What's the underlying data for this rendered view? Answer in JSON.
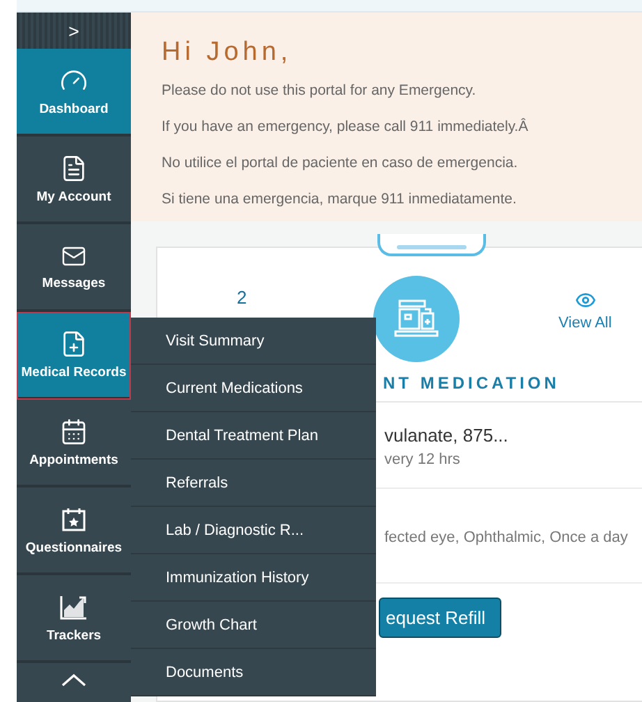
{
  "sidebar": {
    "toggle": ">",
    "items": [
      {
        "label": "Dashboard",
        "selected": true,
        "highlighted": false
      },
      {
        "label": "My Account",
        "selected": false,
        "highlighted": false
      },
      {
        "label": "Messages",
        "selected": false,
        "highlighted": false
      },
      {
        "label": "Medical Records",
        "selected": true,
        "highlighted": true
      },
      {
        "label": "Appointments",
        "selected": false,
        "highlighted": false
      },
      {
        "label": "Questionnaires",
        "selected": false,
        "highlighted": false
      },
      {
        "label": "Trackers",
        "selected": false,
        "highlighted": false
      }
    ]
  },
  "greeting": {
    "title": "Hi John,",
    "lines": [
      "Please do not use this portal for any Emergency.",
      "If you have an emergency, please call 911 immediately.Â",
      "No utilice el portal de paciente en caso de emergencia.",
      "Si tiene una emergencia, marque 911 inmediatamente."
    ]
  },
  "card": {
    "count": "2",
    "view_all": "View All",
    "heading": "NT MEDICATION",
    "medications": [
      {
        "name": "vulanate, 875...",
        "detail": "very 12 hrs"
      },
      {
        "detail": "fected eye, Ophthalmic, Once a day"
      }
    ],
    "button": "equest Refill"
  },
  "submenu": {
    "items": [
      "Visit Summary",
      "Current Medications",
      "Dental Treatment Plan",
      "Referrals",
      "Lab / Diagnostic R...",
      "Immunization History",
      "Growth Chart",
      "Documents"
    ]
  }
}
